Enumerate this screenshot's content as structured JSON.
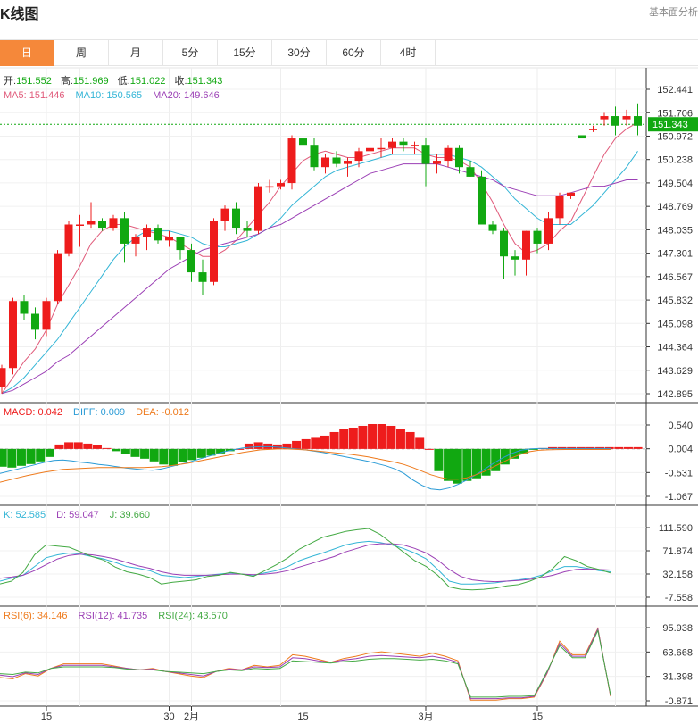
{
  "header": {
    "title": "K线图",
    "analysis_link": "基本面分析"
  },
  "tabs": [
    {
      "label": "日",
      "active": true
    },
    {
      "label": "周",
      "active": false
    },
    {
      "label": "月",
      "active": false
    },
    {
      "label": "5分",
      "active": false
    },
    {
      "label": "15分",
      "active": false
    },
    {
      "label": "30分",
      "active": false
    },
    {
      "label": "60分",
      "active": false
    },
    {
      "label": "4时",
      "active": false
    }
  ],
  "colors": {
    "up": "#ee1c1c",
    "down": "#11a811",
    "ma5": "#e05a7a",
    "ma10": "#33b5d6",
    "ma20": "#9b3fb5",
    "macd": "#ee1c1c",
    "diff": "#2a9bd6",
    "dea": "#ee7a1c",
    "k": "#33b5d6",
    "d": "#9b3fb5",
    "j": "#44aa44",
    "rsi6": "#ee7a1c",
    "rsi12": "#9b3fb5",
    "rsi24": "#44aa44",
    "price_tag": "#11a811"
  },
  "chart_data": {
    "type": "candlestick",
    "price_panel": {
      "ohlc_info": {
        "open_label": "开:",
        "open": "151.552",
        "high_label": "高:",
        "high": "151.969",
        "low_label": "低:",
        "low": "151.022",
        "close_label": "收:",
        "close": "151.343"
      },
      "ma_info": [
        {
          "label": "MA5:",
          "value": "151.446",
          "color_key": "ma5"
        },
        {
          "label": "MA10:",
          "value": "150.565",
          "color_key": "ma10"
        },
        {
          "label": "MA20:",
          "value": "149.646",
          "color_key": "ma20"
        }
      ],
      "ylim": [
        142.895,
        152.441
      ],
      "y_ticks": [
        "152.441",
        "151.706",
        "150.972",
        "150.238",
        "149.504",
        "148.769",
        "148.035",
        "147.301",
        "146.567",
        "145.832",
        "145.098",
        "144.364",
        "143.629",
        "142.895"
      ],
      "last_price": "151.343",
      "candles": [
        [
          143.1,
          143.8,
          142.9,
          143.7
        ],
        [
          143.7,
          145.9,
          143.5,
          145.8
        ],
        [
          145.8,
          146.0,
          145.2,
          145.4
        ],
        [
          145.4,
          145.6,
          144.6,
          144.9
        ],
        [
          144.9,
          145.9,
          144.7,
          145.8
        ],
        [
          145.8,
          147.4,
          145.7,
          147.3
        ],
        [
          147.3,
          148.3,
          147.2,
          148.2
        ],
        [
          148.2,
          148.5,
          147.5,
          148.2
        ],
        [
          148.2,
          148.9,
          148.1,
          148.3
        ],
        [
          148.3,
          148.4,
          148.0,
          148.1
        ],
        [
          148.1,
          148.5,
          148.0,
          148.4
        ],
        [
          148.4,
          148.6,
          147.0,
          147.6
        ],
        [
          147.6,
          147.9,
          147.2,
          147.8
        ],
        [
          147.8,
          148.2,
          147.4,
          148.1
        ],
        [
          148.1,
          148.2,
          147.6,
          147.7
        ],
        [
          147.7,
          148.0,
          147.5,
          147.8
        ],
        [
          147.8,
          147.8,
          147.1,
          147.4
        ],
        [
          147.4,
          147.6,
          146.4,
          146.7
        ],
        [
          146.7,
          147.1,
          146.0,
          146.4
        ],
        [
          146.4,
          148.4,
          146.3,
          148.3
        ],
        [
          148.3,
          148.8,
          148.0,
          148.7
        ],
        [
          148.7,
          148.9,
          147.9,
          148.1
        ],
        [
          148.1,
          148.3,
          147.8,
          148.0
        ],
        [
          148.0,
          149.5,
          147.9,
          149.4
        ],
        [
          149.4,
          149.6,
          149.2,
          149.4
        ],
        [
          149.4,
          149.6,
          149.3,
          149.5
        ],
        [
          149.5,
          151.0,
          149.3,
          150.9
        ],
        [
          150.9,
          151.0,
          150.3,
          150.7
        ],
        [
          150.7,
          150.9,
          149.9,
          150.0
        ],
        [
          150.0,
          150.4,
          149.8,
          150.3
        ],
        [
          150.3,
          150.5,
          150.0,
          150.1
        ],
        [
          150.1,
          150.3,
          149.7,
          150.2
        ],
        [
          150.2,
          150.6,
          150.0,
          150.5
        ],
        [
          150.5,
          150.8,
          150.2,
          150.6
        ],
        [
          150.6,
          150.9,
          150.3,
          150.6
        ],
        [
          150.6,
          150.9,
          150.4,
          150.8
        ],
        [
          150.8,
          150.9,
          150.5,
          150.7
        ],
        [
          150.7,
          150.8,
          150.4,
          150.7
        ],
        [
          150.7,
          150.9,
          149.4,
          150.1
        ],
        [
          150.1,
          150.4,
          149.8,
          150.2
        ],
        [
          150.2,
          150.7,
          150.0,
          150.6
        ],
        [
          150.6,
          150.7,
          149.8,
          150.0
        ],
        [
          150.0,
          150.2,
          149.7,
          149.7
        ],
        [
          149.7,
          149.9,
          148.3,
          148.2
        ],
        [
          148.2,
          148.3,
          147.9,
          148.0
        ],
        [
          148.0,
          148.1,
          146.5,
          147.2
        ],
        [
          147.2,
          147.4,
          146.6,
          147.1
        ],
        [
          147.1,
          148.0,
          146.6,
          148.0
        ],
        [
          148.0,
          148.1,
          147.3,
          147.6
        ],
        [
          147.6,
          148.6,
          147.4,
          148.4
        ],
        [
          148.4,
          149.2,
          148.2,
          149.1
        ],
        [
          149.1,
          149.2,
          149.0,
          149.2
        ],
        [
          151.0,
          151.0,
          150.9,
          150.9
        ],
        [
          151.2,
          151.3,
          151.1,
          151.2
        ],
        [
          151.5,
          151.7,
          151.3,
          151.6
        ],
        [
          151.6,
          151.9,
          151.0,
          151.3
        ],
        [
          151.5,
          151.8,
          151.3,
          151.6
        ],
        [
          151.6,
          152.0,
          151.0,
          151.3
        ]
      ],
      "ma5": [
        142.9,
        143.4,
        143.9,
        144.3,
        144.9,
        145.7,
        146.3,
        146.9,
        147.6,
        148.0,
        148.2,
        148.2,
        148.1,
        148.0,
        147.9,
        147.8,
        147.6,
        147.4,
        147.2,
        147.2,
        147.4,
        147.7,
        148.1,
        148.5,
        148.9,
        149.4,
        149.8,
        150.2,
        150.4,
        150.5,
        150.4,
        150.3,
        150.3,
        150.4,
        150.5,
        150.6,
        150.6,
        150.6,
        150.4,
        150.3,
        150.3,
        150.2,
        150.0,
        149.5,
        148.9,
        148.2,
        147.6,
        147.3,
        147.4,
        147.6,
        148.0,
        148.3,
        149.0,
        149.7,
        150.4,
        150.9,
        151.2,
        151.4
      ],
      "ma10": [
        142.9,
        143.1,
        143.4,
        143.8,
        144.2,
        144.6,
        145.1,
        145.6,
        146.1,
        146.6,
        147.1,
        147.5,
        147.8,
        148.0,
        148.0,
        148.0,
        147.9,
        147.8,
        147.6,
        147.5,
        147.5,
        147.6,
        147.7,
        147.9,
        148.1,
        148.4,
        148.8,
        149.1,
        149.4,
        149.7,
        149.9,
        150.0,
        150.1,
        150.2,
        150.3,
        150.4,
        150.4,
        150.4,
        150.4,
        150.4,
        150.4,
        150.3,
        150.2,
        150.0,
        149.7,
        149.4,
        149.0,
        148.7,
        148.4,
        148.2,
        148.2,
        148.2,
        148.5,
        148.8,
        149.2,
        149.6,
        150.0,
        150.5
      ],
      "ma20": [
        142.9,
        143.0,
        143.2,
        143.4,
        143.6,
        143.9,
        144.1,
        144.4,
        144.7,
        145.0,
        145.3,
        145.6,
        145.9,
        146.2,
        146.5,
        146.8,
        147.0,
        147.2,
        147.4,
        147.5,
        147.6,
        147.7,
        147.8,
        147.9,
        148.1,
        148.2,
        148.4,
        148.6,
        148.8,
        149.0,
        149.2,
        149.4,
        149.6,
        149.8,
        149.9,
        150.0,
        150.1,
        150.1,
        150.1,
        150.1,
        150.0,
        149.9,
        149.8,
        149.7,
        149.6,
        149.4,
        149.3,
        149.2,
        149.1,
        149.1,
        149.1,
        149.2,
        149.3,
        149.4,
        149.4,
        149.5,
        149.6,
        149.6
      ]
    },
    "macd_panel": {
      "info": [
        {
          "label": "MACD:",
          "value": "0.042",
          "color_key": "macd"
        },
        {
          "label": "DIFF:",
          "value": "0.009",
          "color_key": "diff"
        },
        {
          "label": "DEA:",
          "value": "-0.012",
          "color_key": "dea"
        }
      ],
      "ylim": [
        -1.067,
        0.54
      ],
      "y_ticks": [
        "0.540",
        "0.004",
        "-0.531",
        "-1.067"
      ],
      "macd": [
        -0.4,
        -0.42,
        -0.38,
        -0.34,
        -0.28,
        -0.18,
        0.1,
        0.15,
        0.15,
        0.12,
        0.08,
        0.02,
        -0.05,
        -0.12,
        -0.18,
        -0.22,
        -0.28,
        -0.35,
        -0.38,
        -0.3,
        -0.25,
        -0.2,
        -0.15,
        -0.1,
        -0.05,
        0.0,
        0.12,
        0.15,
        0.12,
        0.1,
        0.12,
        0.18,
        0.22,
        0.25,
        0.3,
        0.38,
        0.44,
        0.48,
        0.52,
        0.56,
        0.56,
        0.52,
        0.45,
        0.38,
        0.25,
        0.0,
        -0.5,
        -0.72,
        -0.78,
        -0.72,
        -0.66,
        -0.6,
        -0.5,
        -0.35,
        -0.22,
        -0.1,
        -0.02,
        0.02,
        0.04,
        0.04,
        0.04,
        0.04,
        0.04,
        0.04,
        0.04,
        0.04,
        0.04,
        0.04
      ],
      "diff": [
        -0.55,
        -0.5,
        -0.45,
        -0.4,
        -0.35,
        -0.3,
        -0.26,
        -0.25,
        -0.27,
        -0.3,
        -0.32,
        -0.35,
        -0.37,
        -0.4,
        -0.43,
        -0.45,
        -0.47,
        -0.48,
        -0.45,
        -0.4,
        -0.35,
        -0.3,
        -0.24,
        -0.18,
        -0.12,
        -0.06,
        -0.02,
        0.02,
        0.04,
        0.05,
        0.05,
        0.04,
        0.02,
        0.0,
        -0.02,
        -0.05,
        -0.08,
        -0.12,
        -0.16,
        -0.2,
        -0.24,
        -0.28,
        -0.33,
        -0.38,
        -0.45,
        -0.55,
        -0.7,
        -0.82,
        -0.9,
        -0.92,
        -0.88,
        -0.8,
        -0.7,
        -0.58,
        -0.45,
        -0.32,
        -0.2,
        -0.1,
        -0.03,
        0.0,
        0.01,
        0.01,
        0.01,
        0.01,
        0.01,
        0.01,
        0.01,
        0.01,
        0.009
      ],
      "dea": [
        -0.75,
        -0.7,
        -0.65,
        -0.6,
        -0.56,
        -0.52,
        -0.49,
        -0.46,
        -0.45,
        -0.44,
        -0.43,
        -0.42,
        -0.42,
        -0.42,
        -0.42,
        -0.42,
        -0.42,
        -0.41,
        -0.4,
        -0.38,
        -0.35,
        -0.32,
        -0.28,
        -0.24,
        -0.2,
        -0.16,
        -0.12,
        -0.08,
        -0.05,
        -0.02,
        -0.01,
        0.0,
        0.0,
        -0.01,
        -0.02,
        -0.04,
        -0.06,
        -0.08,
        -0.1,
        -0.12,
        -0.15,
        -0.18,
        -0.22,
        -0.26,
        -0.3,
        -0.35,
        -0.42,
        -0.5,
        -0.58,
        -0.64,
        -0.68,
        -0.68,
        -0.65,
        -0.58,
        -0.5,
        -0.4,
        -0.3,
        -0.2,
        -0.12,
        -0.06,
        -0.03,
        -0.02,
        -0.015,
        -0.013,
        -0.012,
        -0.012,
        -0.012,
        -0.012,
        -0.012
      ]
    },
    "kdj_panel": {
      "info": [
        {
          "label": "K:",
          "value": "52.585",
          "color_key": "k"
        },
        {
          "label": "D:",
          "value": "59.047",
          "color_key": "d"
        },
        {
          "label": "J:",
          "value": "39.660",
          "color_key": "j"
        }
      ],
      "ylim": [
        -7.558,
        111.59
      ],
      "y_ticks": [
        "111.590",
        "71.874",
        "32.158",
        "-7.558"
      ],
      "k": [
        20,
        25,
        30,
        45,
        60,
        65,
        68,
        66,
        62,
        58,
        52,
        45,
        42,
        38,
        30,
        28,
        26,
        28,
        30,
        32,
        34,
        32,
        30,
        34,
        38,
        45,
        55,
        62,
        68,
        75,
        82,
        86,
        88,
        86,
        82,
        76,
        68,
        58,
        40,
        20,
        15,
        15,
        16,
        17,
        20,
        22,
        25,
        30,
        38,
        45,
        45,
        42,
        38,
        36
      ],
      "d": [
        25,
        27,
        30,
        38,
        48,
        58,
        64,
        66,
        65,
        62,
        58,
        52,
        46,
        42,
        36,
        32,
        30,
        30,
        30,
        31,
        32,
        32,
        31,
        32,
        34,
        38,
        44,
        50,
        56,
        62,
        70,
        76,
        82,
        84,
        84,
        82,
        76,
        68,
        56,
        40,
        28,
        22,
        20,
        19,
        20,
        21,
        23,
        26,
        30,
        36,
        40,
        41,
        40,
        39
      ],
      "j": [
        15,
        20,
        35,
        65,
        82,
        80,
        78,
        70,
        62,
        56,
        44,
        36,
        32,
        26,
        15,
        18,
        20,
        22,
        28,
        30,
        35,
        32,
        28,
        38,
        48,
        60,
        75,
        85,
        95,
        100,
        105,
        108,
        110,
        100,
        85,
        70,
        55,
        45,
        30,
        10,
        6,
        5,
        6,
        8,
        12,
        14,
        20,
        28,
        42,
        62,
        55,
        45,
        40,
        34
      ]
    },
    "rsi_panel": {
      "info": [
        {
          "label": "RSI(6):",
          "value": "34.146",
          "color_key": "rsi6"
        },
        {
          "label": "RSI(12):",
          "value": "41.735",
          "color_key": "rsi12"
        },
        {
          "label": "RSI(24):",
          "value": "43.570",
          "color_key": "rsi24"
        }
      ],
      "ylim": [
        -0.871,
        95.938
      ],
      "y_ticks": [
        "95.938",
        "63.668",
        "31.398",
        "-0.871"
      ],
      "rsi6": [
        30,
        28,
        35,
        32,
        42,
        48,
        48,
        48,
        48,
        45,
        42,
        40,
        42,
        38,
        35,
        32,
        30,
        38,
        42,
        40,
        46,
        44,
        46,
        60,
        58,
        54,
        50,
        55,
        58,
        62,
        64,
        62,
        60,
        58,
        62,
        58,
        52,
        0,
        0,
        0,
        2,
        2,
        4,
        35,
        78,
        60,
        60,
        95,
        5
      ],
      "rsi12": [
        33,
        31,
        36,
        34,
        42,
        46,
        46,
        46,
        46,
        44,
        42,
        40,
        41,
        38,
        36,
        34,
        32,
        38,
        41,
        40,
        44,
        43,
        44,
        56,
        55,
        52,
        50,
        53,
        55,
        58,
        59,
        58,
        57,
        56,
        58,
        55,
        50,
        2,
        2,
        2,
        3,
        3,
        5,
        36,
        75,
        58,
        58,
        94,
        6
      ],
      "rsi24": [
        35,
        34,
        37,
        36,
        42,
        44,
        44,
        44,
        44,
        43,
        41,
        40,
        40,
        38,
        37,
        36,
        35,
        38,
        40,
        39,
        42,
        41,
        42,
        52,
        51,
        50,
        49,
        51,
        52,
        54,
        55,
        55,
        54,
        53,
        54,
        52,
        48,
        4,
        4,
        4,
        5,
        5,
        6,
        38,
        72,
        56,
        56,
        92,
        7
      ]
    },
    "x_axis": {
      "labels": [
        {
          "text": "15",
          "index": 4
        },
        {
          "text": "30",
          "index": 15
        },
        {
          "text": "2月",
          "index": 17
        },
        {
          "text": "15",
          "index": 27
        },
        {
          "text": "3月",
          "index": 38
        },
        {
          "text": "15",
          "index": 48
        }
      ],
      "minor_ticks": [
        7,
        25,
        55
      ]
    }
  }
}
